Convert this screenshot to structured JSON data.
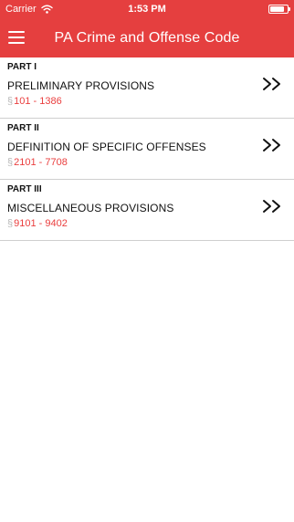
{
  "status_bar": {
    "carrier": "Carrier",
    "time": "1:53 PM",
    "battery_level": 0.85
  },
  "header": {
    "title": "PA Crime and Offense Code",
    "accent_color": "#e53f3f"
  },
  "parts": [
    {
      "label": "PART I",
      "title": "PRELIMINARY PROVISIONS",
      "section_symbol": "§",
      "range": "101 - 1386",
      "icon": "double-chevron-right-icon"
    },
    {
      "label": "PART II",
      "title": "DEFINITION OF SPECIFIC OFFENSES",
      "section_symbol": "§",
      "range": "2101 - 7708",
      "icon": "double-chevron-right-icon"
    },
    {
      "label": "PART III",
      "title": "MISCELLANEOUS PROVISIONS",
      "section_symbol": "§",
      "range": "9101 - 9402",
      "icon": "double-chevron-right-icon"
    }
  ]
}
